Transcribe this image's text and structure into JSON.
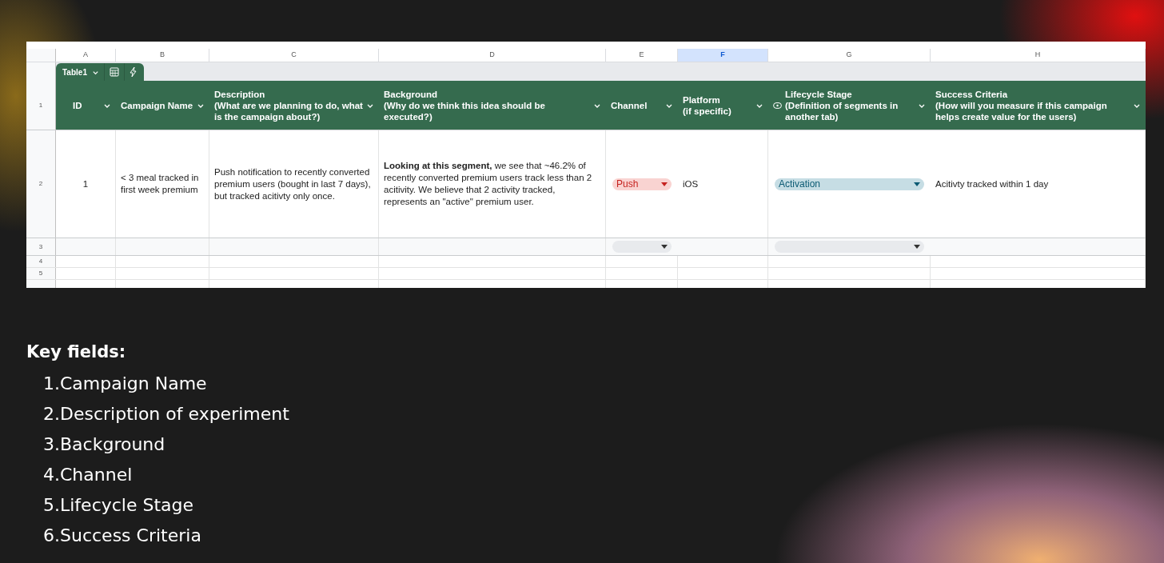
{
  "sheet": {
    "column_letters": [
      {
        "label": "A",
        "selected": false
      },
      {
        "label": "B",
        "selected": false
      },
      {
        "label": "C",
        "selected": false
      },
      {
        "label": "D",
        "selected": false
      },
      {
        "label": "E",
        "selected": false
      },
      {
        "label": "F",
        "selected": true
      },
      {
        "label": "G",
        "selected": false
      },
      {
        "label": "H",
        "selected": false
      }
    ],
    "row_numbers": [
      "1",
      "2",
      "3",
      "4",
      "5"
    ],
    "table_tab": {
      "name": "Table1"
    },
    "headers": [
      {
        "title": "ID",
        "linked": false
      },
      {
        "title": "Campaign Name",
        "linked": false
      },
      {
        "title": "Description",
        "note": "(What are we planning to do, what is the campaign about?)",
        "linked": false
      },
      {
        "title": "Background",
        "note": "(Why do we think this idea should be executed?)",
        "linked": false
      },
      {
        "title": "Channel",
        "linked": false
      },
      {
        "title": "Platform",
        "note": "(if specific)",
        "linked": false
      },
      {
        "title": "Lifecycle Stage",
        "note": "(Definition of segments in another tab)",
        "linked": true
      },
      {
        "title": "Success Criteria",
        "note": "(How will you measure if this campaign helps create value for the users)",
        "linked": false
      }
    ],
    "rows": [
      {
        "cells": [
          {
            "kind": "number",
            "text": "1"
          },
          {
            "kind": "text",
            "text": "< 3 meal tracked in first week premium"
          },
          {
            "kind": "text",
            "text": "Push notification to recently converted premium users (bought in last 7 days), but tracked acitivty only once."
          },
          {
            "kind": "text",
            "text": "**Looking at this segment,** we see that ~46.2% of recently converted premium users track less than 2 acitivity. We believe that 2 activity tracked, represents an \"active\" premium user."
          },
          {
            "kind": "chip",
            "text": "Push",
            "color": "#f9d3d1"
          },
          {
            "kind": "text",
            "text": "iOS"
          },
          {
            "kind": "chip",
            "text": "Activation",
            "color": "#c6dde4"
          },
          {
            "kind": "text",
            "text": "Acitivty tracked within 1 day"
          }
        ]
      },
      {
        "cells": [
          {
            "kind": "blank"
          },
          {
            "kind": "blank"
          },
          {
            "kind": "blank"
          },
          {
            "kind": "blank"
          },
          {
            "kind": "chip",
            "color": "#e8eaed"
          },
          {
            "kind": "blank"
          },
          {
            "kind": "chip",
            "color": "#e8eaed"
          },
          {
            "kind": "blank"
          }
        ]
      }
    ]
  },
  "key_fields": {
    "title": "Key fields:",
    "items": [
      {
        "number": "1.",
        "text": "Campaign Name"
      },
      {
        "number": "2.",
        "text": "Description of experiment"
      },
      {
        "number": "3.",
        "text": "Background"
      },
      {
        "number": "4.",
        "text": "Channel"
      },
      {
        "number": "5.",
        "text": "Lifecycle Stage"
      },
      {
        "number": "6.",
        "text": "Success Criteria"
      }
    ]
  }
}
